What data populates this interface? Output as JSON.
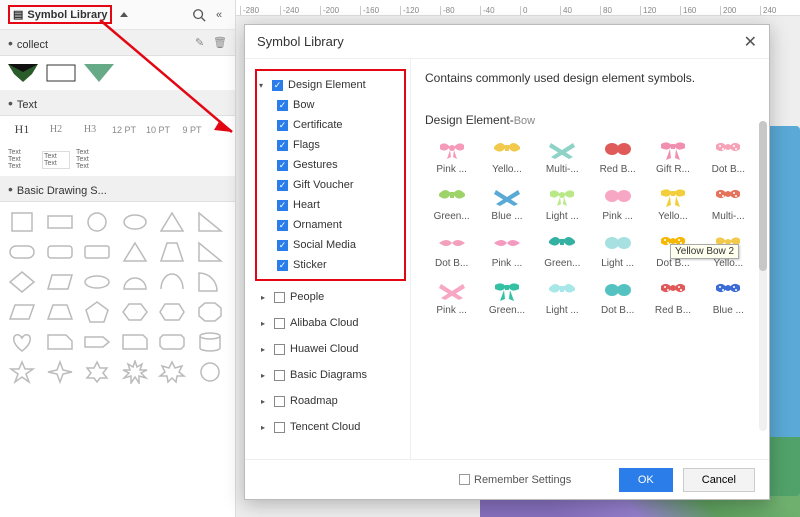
{
  "sidebar": {
    "symbol_library_label": "Symbol Library",
    "collect": {
      "title": "collect"
    },
    "text": {
      "title": "Text",
      "h1": "H1",
      "h2": "H2",
      "h3": "H3",
      "pt12": "12 PT",
      "pt10": "10 PT",
      "pt9": "9 PT",
      "sample": "Text\nText\nText"
    },
    "shapes": {
      "title": "Basic Drawing S..."
    }
  },
  "ruler": [
    "-280",
    "-240",
    "-200",
    "-160",
    "-120",
    "-80",
    "-40",
    "0",
    "40",
    "80",
    "120",
    "160",
    "200",
    "240"
  ],
  "modal": {
    "title": "Symbol Library",
    "close": "✕",
    "description": "Contains commonly used design element symbols.",
    "section_title": "Design Element-",
    "section_sub": "Bow",
    "remember": "Remember Settings",
    "ok": "OK",
    "cancel": "Cancel",
    "tooltip": "Yellow Bow 2"
  },
  "tree": {
    "design_element": {
      "label": "Design Element",
      "expanded": true,
      "checked": true,
      "children": [
        {
          "label": "Bow"
        },
        {
          "label": "Certificate"
        },
        {
          "label": "Flags"
        },
        {
          "label": "Gestures"
        },
        {
          "label": "Gift Voucher"
        },
        {
          "label": "Heart"
        },
        {
          "label": "Ornament"
        },
        {
          "label": "Social Media"
        },
        {
          "label": "Sticker"
        }
      ]
    },
    "others": [
      {
        "label": "People"
      },
      {
        "label": "Alibaba Cloud"
      },
      {
        "label": "Huawei Cloud"
      },
      {
        "label": "Basic Diagrams"
      },
      {
        "label": "Roadmap"
      },
      {
        "label": "Tencent Cloud"
      }
    ]
  },
  "symbols": [
    {
      "cap": "Pink ...",
      "c": "#f59ab8",
      "v": 1
    },
    {
      "cap": "Yello...",
      "c": "#f2c94c",
      "v": 2
    },
    {
      "cap": "Multi-...",
      "c": "#8fd3c7",
      "v": 3
    },
    {
      "cap": "Red B...",
      "c": "#e05a5a",
      "v": 4
    },
    {
      "cap": "Gift R...",
      "c": "#f08fb0",
      "v": 5
    },
    {
      "cap": "Dot B...",
      "c": "#f6a3b8",
      "v": 6
    },
    {
      "cap": "Green...",
      "c": "#9ed36a",
      "v": 2
    },
    {
      "cap": "Blue ...",
      "c": "#5aa9d6",
      "v": 3
    },
    {
      "cap": "Light ...",
      "c": "#b8e986",
      "v": 1
    },
    {
      "cap": "Pink ...",
      "c": "#f7a7c4",
      "v": 4
    },
    {
      "cap": "Yello...",
      "c": "#f2cf3a",
      "v": 5
    },
    {
      "cap": "Multi-...",
      "c": "#e5735c",
      "v": 6
    },
    {
      "cap": "Dot B...",
      "c": "#f2a0bb",
      "v": 7
    },
    {
      "cap": "Pink ...",
      "c": "#f49ac0",
      "v": 7
    },
    {
      "cap": "Green...",
      "c": "#34b1a3",
      "v": 2
    },
    {
      "cap": "Light ...",
      "c": "#a6e0e0",
      "v": 4
    },
    {
      "cap": "Dot B...",
      "c": "#f5b700",
      "v": 6
    },
    {
      "cap": "Yello...",
      "c": "#f2c94c",
      "v": 1
    },
    {
      "cap": "Pink ...",
      "c": "#f7a7c4",
      "v": 3
    },
    {
      "cap": "Green...",
      "c": "#34c1a3",
      "v": 5
    },
    {
      "cap": "Light ...",
      "c": "#a7e7e7",
      "v": 2
    },
    {
      "cap": "Dot B...",
      "c": "#55c2c2",
      "v": 4
    },
    {
      "cap": "Red B...",
      "c": "#e05a5a",
      "v": 6
    },
    {
      "cap": "Blue ...",
      "c": "#3a6bd6",
      "v": 6
    }
  ],
  "colors": {
    "brand_red": "#e30613",
    "brand_blue": "#2b7de9"
  }
}
